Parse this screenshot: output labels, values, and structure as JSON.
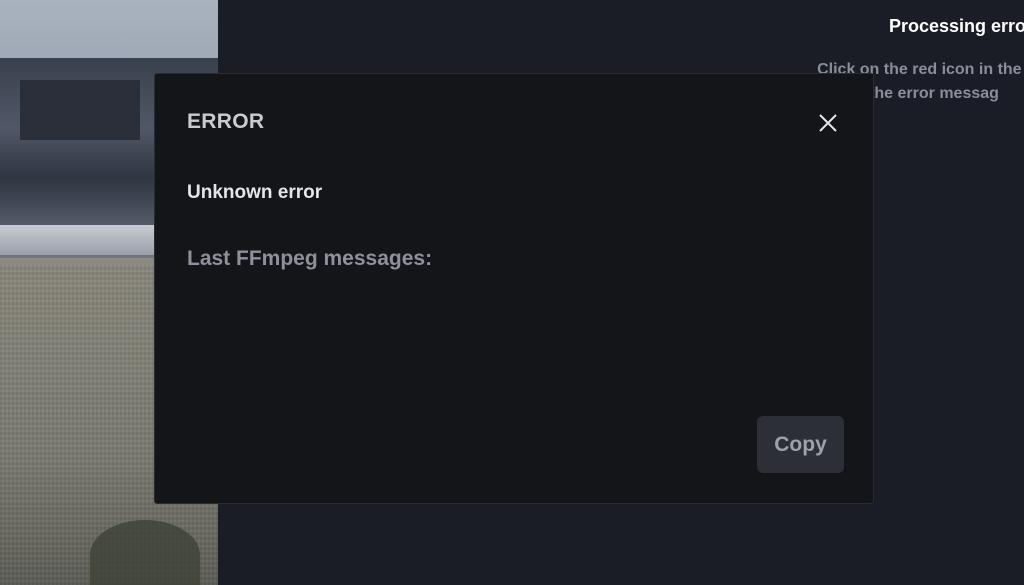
{
  "background_panel": {
    "title": "Processing erro",
    "description_line1": "Click on the red icon in the out",
    "description_line2": "the error messag"
  },
  "modal": {
    "title": "ERROR",
    "close_icon": "close-icon",
    "message": "Unknown error",
    "subheading": "Last FFmpeg messages:",
    "copy_label": "Copy"
  },
  "colors": {
    "background": "#1b1d26",
    "modal_bg": "#141519",
    "button_bg": "#2d2f36",
    "title_text": "#c9cbd1",
    "muted_text": "#8e919c"
  }
}
